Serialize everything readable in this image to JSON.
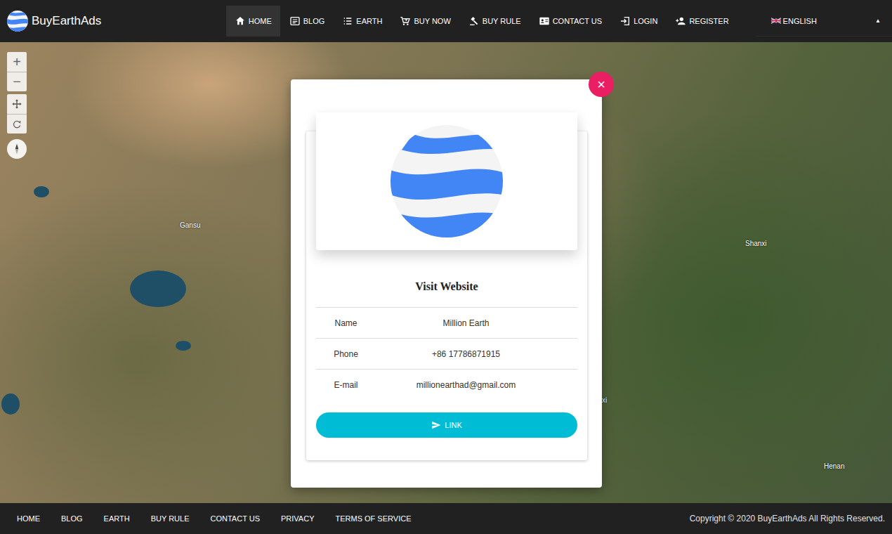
{
  "brand": "BuyEarthAds",
  "nav": [
    {
      "label": "HOME",
      "selected": true
    },
    {
      "label": "BLOG",
      "selected": false
    },
    {
      "label": "EARTH",
      "selected": false
    },
    {
      "label": "BUY NOW",
      "selected": false
    },
    {
      "label": "BUY RULE",
      "selected": false
    },
    {
      "label": "CONTACT US",
      "selected": false
    },
    {
      "label": "LOGIN",
      "selected": false
    },
    {
      "label": "REGISTER",
      "selected": false
    }
  ],
  "language": {
    "label": "ENGLISH",
    "caret": "▲"
  },
  "map": {
    "zoom_in": "+",
    "zoom_out": "−",
    "labels": [
      {
        "text": "Gansu"
      },
      {
        "text": "Shanxi"
      },
      {
        "text": "xi"
      },
      {
        "text": "Henan"
      }
    ]
  },
  "modal": {
    "close": "×",
    "title": "Visit Website",
    "fields": [
      {
        "label": "Name",
        "value": "Million Earth"
      },
      {
        "label": "Phone",
        "value": "+86 17786871915"
      },
      {
        "label": "E-mail",
        "value": "millionearthad@gmail.com"
      }
    ],
    "button": "LINK"
  },
  "footer": {
    "links": [
      "HOME",
      "BLOG",
      "EARTH",
      "BUY RULE",
      "CONTACT US",
      "PRIVACY",
      "TERMS OF SERVICE"
    ],
    "copyright": "Copyright © 2020 BuyEarthAds All Rights Reserved."
  }
}
